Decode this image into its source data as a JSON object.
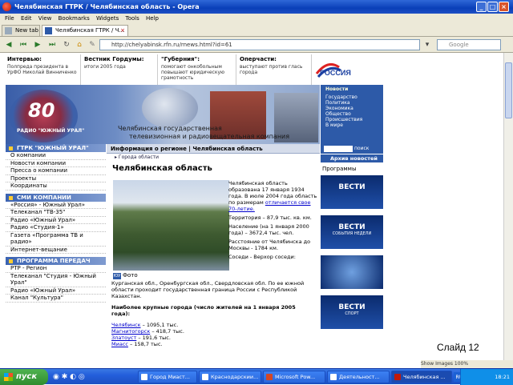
{
  "window": {
    "title": "Челябинская ГТРК / Челябинская область - Opera"
  },
  "menu": [
    "File",
    "Edit",
    "View",
    "Bookmarks",
    "Widgets",
    "Tools",
    "Help"
  ],
  "tabs": [
    {
      "label": "New tab"
    },
    {
      "label": "Челябинская ГТРК / Ч..."
    }
  ],
  "address": {
    "url": "http://chelyabinsk.rfn.ru/rnews.html?id=61",
    "search_placeholder": "Google"
  },
  "topnews": [
    {
      "head": "Интервью:",
      "text": "Полпреда президента в УрФО Николай Винниченко"
    },
    {
      "head": "Вестник Гордумы:",
      "text": "итоги 2005 года"
    },
    {
      "head": "\"Губерния\":",
      "text": "помогают онкобольным повышают юридическую грамотность"
    },
    {
      "head": "Оперчасти:",
      "text": "выступают против глась города"
    }
  ],
  "rossiya_logo": "РОССИЯ",
  "banner": {
    "big": "80",
    "radio": "РАДИО \"ЮЖНЫЙ УРАЛ\"",
    "caption1": "Челябинская государственная",
    "caption2": "телевизионная и радиовещательная компания"
  },
  "rightnav": {
    "head": "Новости",
    "items": [
      "Государство",
      "Политика",
      "Экономика",
      "Общество",
      "Происшествия",
      "В мире"
    ]
  },
  "rsearch": {
    "button": "поиск"
  },
  "left": {
    "sec1": "ГТРК \"ЮЖНЫЙ УРАЛ\"",
    "sec1_items": [
      "О компании",
      "Новости компании",
      "Пресса о компании",
      "Проекты",
      "Координаты"
    ],
    "sec2": "СМИ КОМПАНИИ",
    "sec2_items": [
      "«Россия» - Южный Урал»",
      "Телеканал \"ТВ-35\"",
      "Радио «Южный Урал»",
      "Радио «Студия-1»",
      "Газета «Программа ТВ и радио»",
      "Интернет-вещание"
    ],
    "sec3": "ПРОГРАММА ПЕРЕДАЧ",
    "sec3_items": [
      "РТР - Регион",
      "Телеканал \"Студия - Южный Урал\"",
      "Радио «Южный Урал»",
      "Канал \"Культура\""
    ]
  },
  "main": {
    "bar": "Информация о регионе | Челябинская область",
    "crumb": "Города области",
    "title": "Челябинская область",
    "facts": [
      "Челябинская область образована 17 января 1934 года. В июле 2004 года область по размерам ",
      "Территория – 87,9 тыс. кв. км.",
      "Население (на 1 января 2000 года) – 3672,4 тыс. чел.",
      "Расстояние от Челябинска до Москвы - 1784 км.",
      "Соседи - Верхор соседи:"
    ],
    "facts_link": "отличается свое 70-летие.",
    "foto": "Фото",
    "foto_badge": "ЮУ",
    "borders": "Курганская обл., Оренбургская обл., Свердловская обл. По ее южной области проходит государственная граница России с Республикой Казахстан.",
    "cities_head": "Наиболее крупные города (число жителей на 1 января 2005 года):",
    "cities": [
      {
        "name": "Челябинск",
        "value": " – 1095,1 тыс."
      },
      {
        "name": "Магнитогорск",
        "value": " – 418,7 тыс."
      },
      {
        "name": "Златоуст",
        "value": " – 191,6 тыс."
      },
      {
        "name": "Миасс",
        "value": " – 158,7 тыс."
      }
    ]
  },
  "rightbar": {
    "archive": "Архив новостей",
    "programs": "Программы"
  },
  "vesti": [
    {
      "t": "ВЕСТИ",
      "s": ""
    },
    {
      "t": "ВЕСТИ",
      "s": "СОБЫТИЯ НЕДЕЛИ"
    },
    {
      "t": "",
      "s": ""
    },
    {
      "t": "ВЕСТИ",
      "s": "СПОРТ"
    }
  ],
  "slide": "Слайд 12",
  "zoomstat": "Show Images      100%",
  "taskbar": {
    "start": "пуск",
    "buttons": [
      "Город Миаст...",
      "Краснодарскии...",
      "Microsoft Pow...",
      "Деятельност...",
      "Челябинская ..."
    ],
    "lang": "RU",
    "clock": "18:21"
  }
}
